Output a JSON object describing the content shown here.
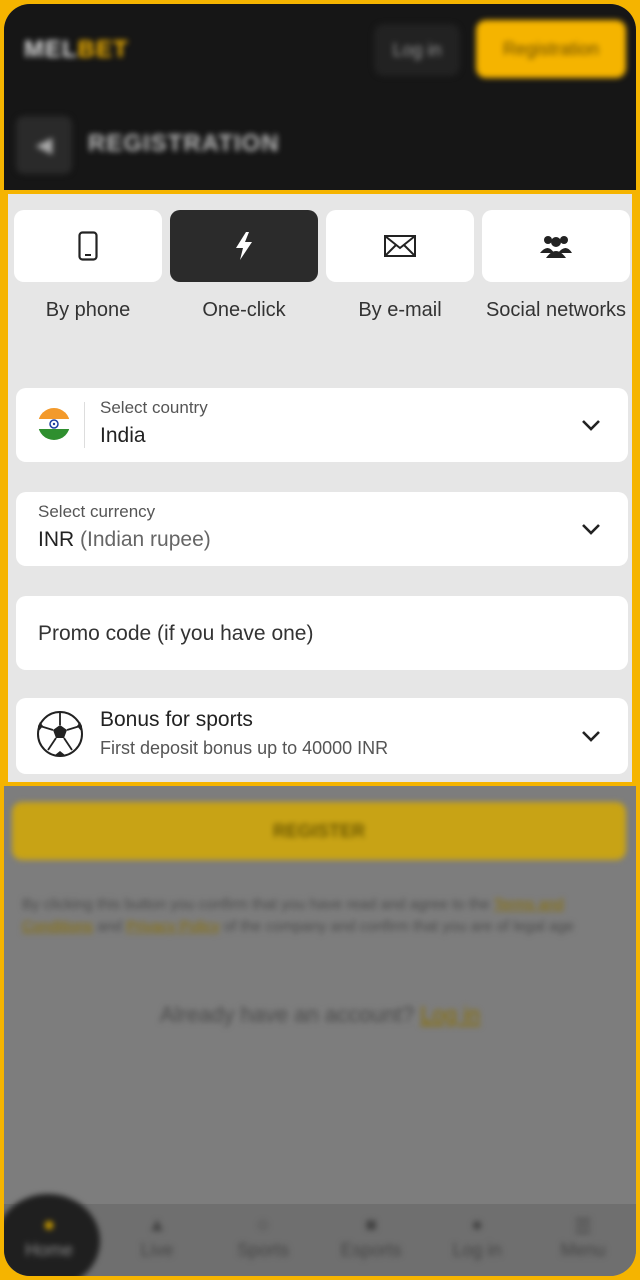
{
  "header": {
    "logo_main": "MEL",
    "logo_accent": "BET",
    "login_label": "Log in",
    "registration_label": "Registration",
    "page_title": "REGISTRATION"
  },
  "tabs": [
    {
      "label": "By phone",
      "icon": "phone-icon",
      "active": false
    },
    {
      "label": "One-click",
      "icon": "lightning-icon",
      "active": true
    },
    {
      "label": "By e-mail",
      "icon": "envelope-icon",
      "active": false
    },
    {
      "label": "Social networks",
      "icon": "users-icon",
      "active": false
    }
  ],
  "country": {
    "label": "Select country",
    "value": "India",
    "flag_icon": "india-flag-icon"
  },
  "currency": {
    "label": "Select currency",
    "code": "INR",
    "name": "(Indian rupee)"
  },
  "promo": {
    "placeholder": "Promo code (if you have one)"
  },
  "bonus": {
    "title": "Bonus for sports",
    "subtitle": "First deposit bonus up to 40000 INR",
    "icon": "soccer-ball-icon"
  },
  "register_button": "REGISTER",
  "terms": {
    "text_1": "By clicking this button you confirm that you have read and agree to the",
    "link_terms": "Terms and Conditions",
    "text_2": "and",
    "link_privacy": "Privacy Policy",
    "text_3": "of the company and confirm that you are of legal age"
  },
  "account": {
    "question": "Already have an account?",
    "login_link": "Log in"
  },
  "bottom_nav": [
    {
      "label": "Home",
      "icon": "home-icon"
    },
    {
      "label": "Live",
      "icon": "fire-icon"
    },
    {
      "label": "Sports",
      "icon": "ball-icon"
    },
    {
      "label": "Esports",
      "icon": "gamepad-icon"
    },
    {
      "label": "Log in",
      "icon": "user-icon"
    },
    {
      "label": "Menu",
      "icon": "menu-icon"
    }
  ],
  "colors": {
    "accent": "#f5b400",
    "active_tab": "#2b2b2b",
    "panel_bg": "#e6e6e6"
  }
}
